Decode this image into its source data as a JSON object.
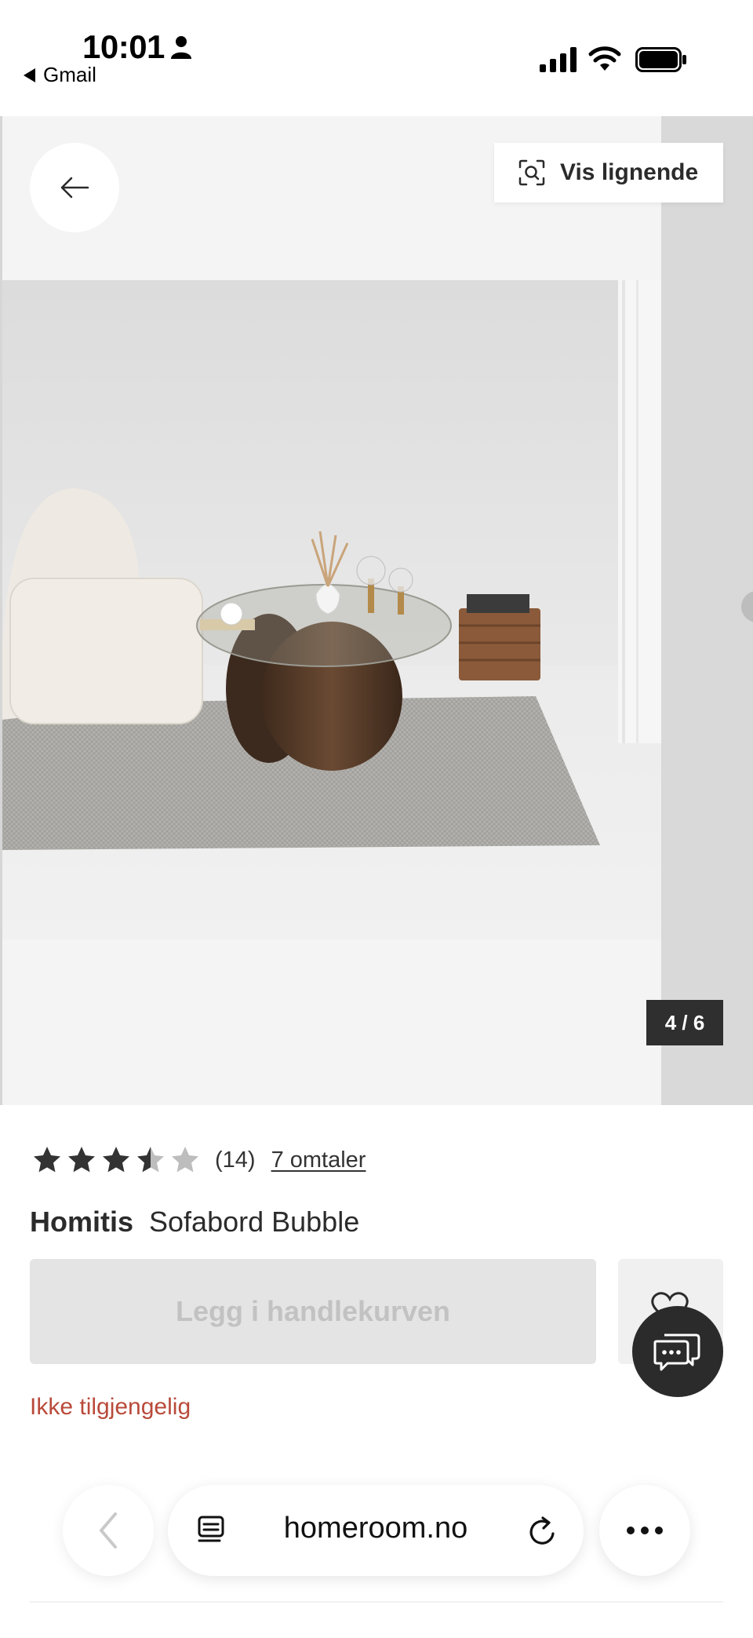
{
  "status_bar": {
    "time": "10:01",
    "back_app": "Gmail"
  },
  "gallery": {
    "similar_label": "Vis lignende",
    "counter": "4 / 6"
  },
  "product": {
    "rating": 3.5,
    "max_rating": 5,
    "review_count": "(14)",
    "reviews_link": "7 omtaler",
    "brand": "Homitis",
    "name": "Sofabord Bubble",
    "cart_label": "Legg i handlekurven",
    "availability": "Ikke tilgjengelig",
    "availability_color": "#b94a3a"
  },
  "browser": {
    "url": "homeroom.no"
  },
  "colors": {
    "text": "#2b2b2b",
    "disabled_button": "#e4e4e4",
    "chat_button": "#2b2b2b"
  }
}
